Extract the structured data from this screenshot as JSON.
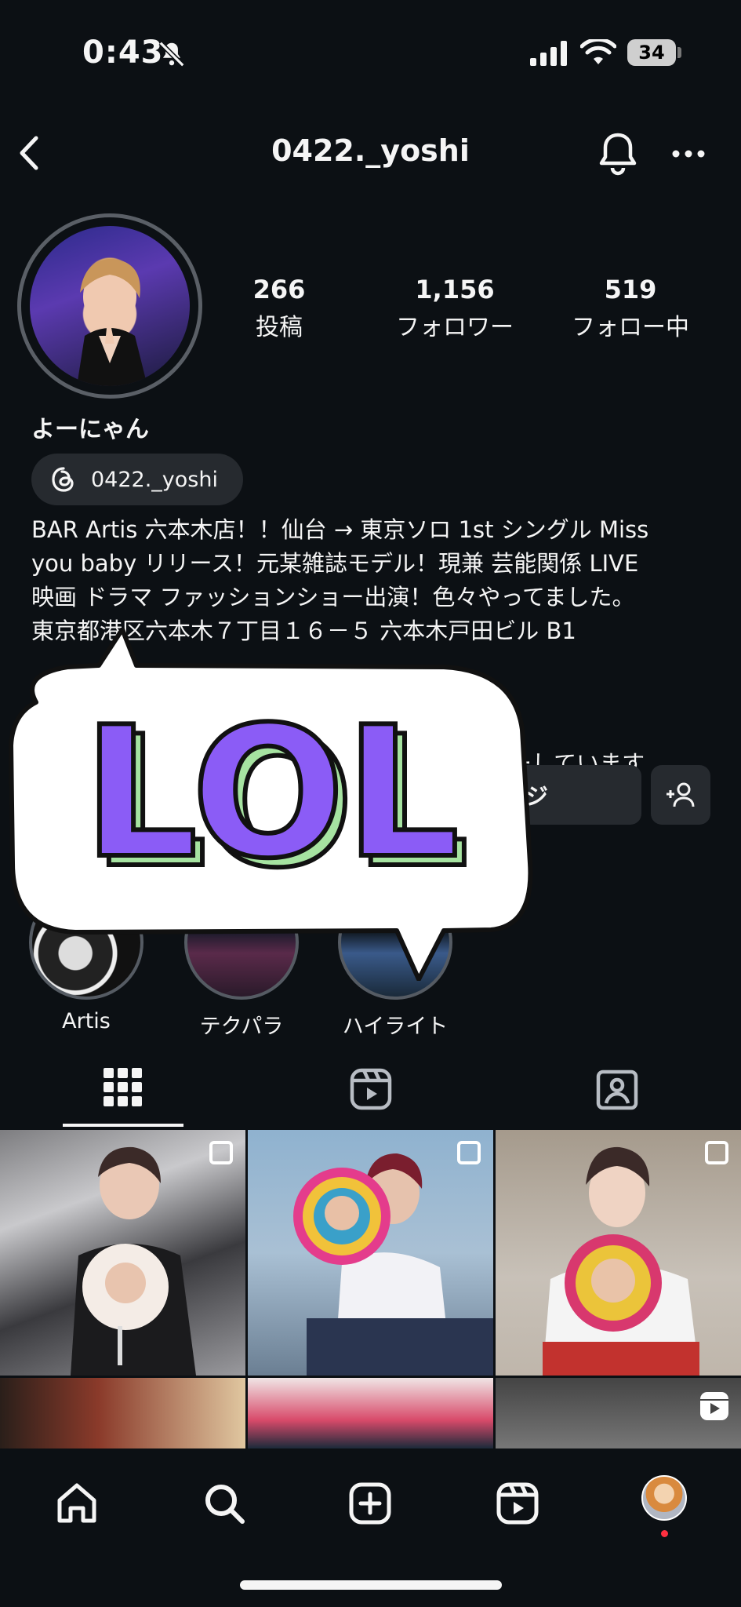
{
  "status_bar": {
    "time": "0:43",
    "battery": "34"
  },
  "header": {
    "username": "0422._yoshi"
  },
  "profile": {
    "posts_count": "266",
    "posts_label": "投稿",
    "followers_count": "1,156",
    "followers_label": "フォロワー",
    "following_count": "519",
    "following_label": "フォロー中",
    "display_name": "よーにゃん",
    "threads_handle": "0422._yoshi",
    "bio_lines": [
      "BAR Artis 六本木店！！仙台 → 東京ソロ 1st シングル Miss",
      "you baby リリース！元某雑誌モデル！現兼 芸能関係 LIVE",
      "映画 ドラマ ファッションショー出演！色々やってました。",
      "東京都港区六本木７丁目１６－５ 六本木戸田ビル B1"
    ],
    "followed_by_line1": "：",
    "followed_by_line2": "ローしています"
  },
  "buttons": {
    "message_label": "ジ"
  },
  "highlights": [
    {
      "label": "Artis"
    },
    {
      "label": "テクパラ"
    },
    {
      "label": "ハイライト"
    }
  ],
  "sticker": {
    "text": "LOL"
  },
  "colors": {
    "background": "#0c1014",
    "button_bg": "#262a2f",
    "sticker_purple": "#8b5cf6",
    "sticker_green": "#a6e3a1",
    "notification_dot": "#ff3040"
  },
  "icons": [
    "mute-icon",
    "signal-icon",
    "wifi-icon",
    "back-icon",
    "bell-icon",
    "more-icon",
    "threads-icon",
    "add-user-icon",
    "grid-icon",
    "reels-icon",
    "tagged-icon",
    "home-icon",
    "search-icon",
    "create-icon",
    "reels-nav-icon"
  ]
}
